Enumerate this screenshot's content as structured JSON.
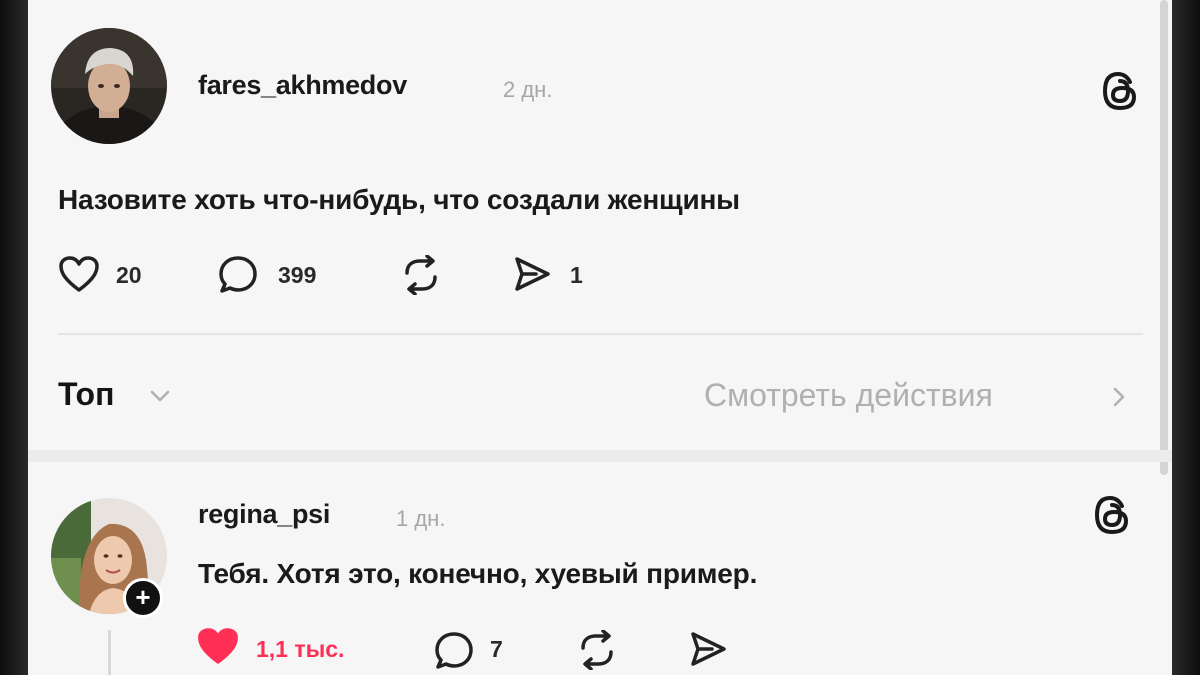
{
  "post": {
    "username": "fares_akhmedov",
    "age": "2 дн.",
    "text": "Назовите хоть что-нибудь, что создали женщины",
    "likes": "20",
    "comments": "399",
    "shares": "1"
  },
  "sort_bar": {
    "sort_label": "Топ",
    "view_activity": "Смотреть действия"
  },
  "reply": {
    "username": "regina_psi",
    "age": "1 дн.",
    "text": "Тебя. Хотя это, конечно, хуевый пример.",
    "likes": "1,1 тыс.",
    "comments": "7",
    "follow_glyph": "+"
  },
  "colors": {
    "like_active": "#ff2f55",
    "background": "#f6f6f6",
    "muted_text": "#a6a6a6"
  },
  "icons": [
    "heart-icon",
    "comment-icon",
    "repost-icon",
    "send-icon",
    "threads-logo-icon",
    "chevron-down-icon",
    "chevron-right-icon"
  ]
}
